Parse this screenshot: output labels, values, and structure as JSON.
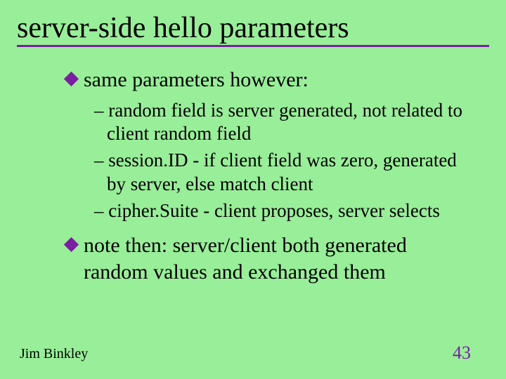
{
  "title": "server-side hello parameters",
  "bullets": [
    {
      "text": "same parameters however:",
      "sub": [
        "random field is server generated, not related to client random field",
        "session.ID - if client field was zero, generated by server, else match client",
        "cipher.Suite - client proposes, server selects"
      ]
    },
    {
      "text": "note then: server/client both generated random values and exchanged them",
      "sub": []
    }
  ],
  "footer": {
    "author": "Jim Binkley",
    "page": "43"
  },
  "colors": {
    "accent": "#7a1fa2",
    "bg": "#99ee99"
  }
}
